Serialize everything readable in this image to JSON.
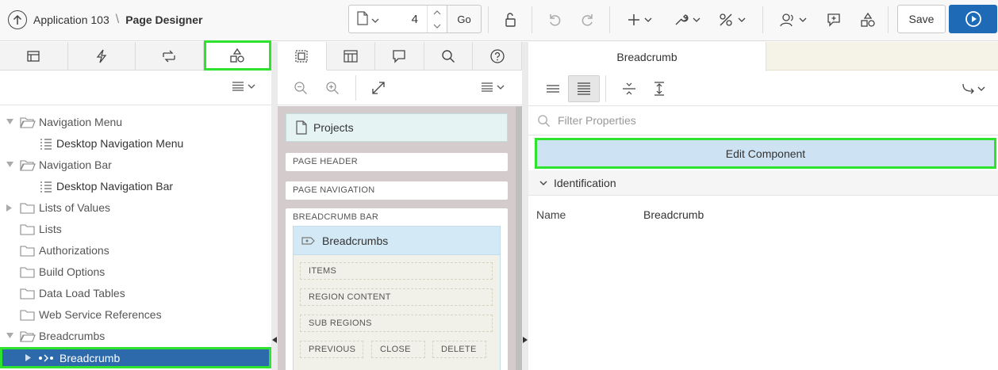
{
  "header": {
    "app_title": "Application 103",
    "separator": "\\",
    "page_title": "Page Designer",
    "page_number": "4",
    "go_label": "Go",
    "save_label": "Save"
  },
  "left": {
    "tree": [
      {
        "label": "Navigation Menu",
        "kind": "folder-open",
        "expanded": true
      },
      {
        "label": "Desktop Navigation Menu",
        "kind": "child"
      },
      {
        "label": "Navigation Bar",
        "kind": "folder-open",
        "expanded": true
      },
      {
        "label": "Desktop Navigation Bar",
        "kind": "child"
      },
      {
        "label": "Lists of Values",
        "kind": "folder",
        "expanded": false
      },
      {
        "label": "Lists",
        "kind": "folder"
      },
      {
        "label": "Authorizations",
        "kind": "folder"
      },
      {
        "label": "Build Options",
        "kind": "folder"
      },
      {
        "label": "Data Load Tables",
        "kind": "folder"
      },
      {
        "label": "Web Service References",
        "kind": "folder"
      },
      {
        "label": "Breadcrumbs",
        "kind": "folder-open",
        "expanded": true
      },
      {
        "label": "Breadcrumb",
        "kind": "selected"
      }
    ]
  },
  "middle": {
    "page_name": "Projects",
    "regions": {
      "page_header": "PAGE HEADER",
      "page_navigation": "PAGE NAVIGATION",
      "breadcrumb_bar": "BREADCRUMB BAR"
    },
    "component": {
      "title": "Breadcrumbs",
      "slots": {
        "items": "ITEMS",
        "region_content": "REGION CONTENT",
        "sub_regions": "SUB REGIONS",
        "previous": "PREVIOUS",
        "close": "CLOSE",
        "delete": "DELETE"
      }
    }
  },
  "right": {
    "tab_label": "Breadcrumb",
    "filter_placeholder": "Filter Properties",
    "edit_component_label": "Edit Component",
    "section_label": "Identification",
    "properties": {
      "name_key": "Name",
      "name_value": "Breadcrumb"
    }
  },
  "colors": {
    "accent": "#1f6ab6",
    "highlight": "#2ee32e",
    "selected_row": "#2d6aab"
  }
}
